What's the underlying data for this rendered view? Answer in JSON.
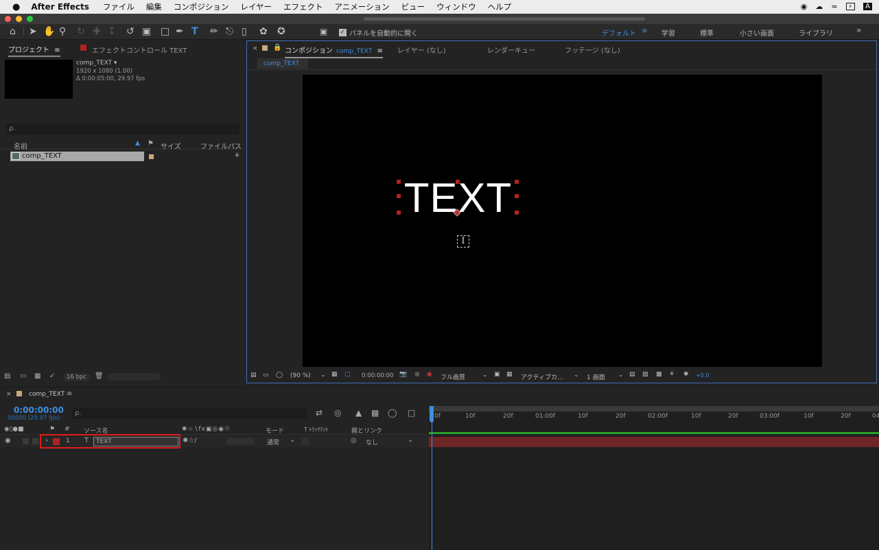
{
  "menubar": {
    "apple_icon": "apple-logo",
    "app_name": "After Effects",
    "items": [
      "ファイル",
      "編集",
      "コンポジション",
      "レイヤー",
      "エフェクト",
      "アニメーション",
      "ビュー",
      "ウィンドウ",
      "ヘルプ"
    ],
    "input_indicator": "A"
  },
  "toolbar": {
    "auto_open_label": "パネルを自動的に開く",
    "workspaces": [
      "デフォルト",
      "学習",
      "標準",
      "小さい画面",
      "ライブラリ"
    ],
    "more": "»"
  },
  "project_panel": {
    "tab_project": "プロジェクト",
    "tab_effect_controls": "エフェクトコントロール TEXT",
    "item_name": "comp_TEXT ▾",
    "item_resolution": "1920 x 1080 (1.00)",
    "item_duration": "Δ 0:00:05:00, 29.97 fps",
    "search_placeholder": "ρ.",
    "col_name": "名前",
    "col_size": "サイズ",
    "col_filepath": "ファイルパス",
    "row_name": "comp_TEXT",
    "bpc": "16 bpc"
  },
  "comp_panel": {
    "tab_composition": "コンポジション",
    "tab_comp_name": "comp_TEXT",
    "tab_layer": "レイヤー (なし)",
    "tab_render_queue": "レンダーキュー",
    "tab_footage": "フッテージ (なし)",
    "sub_tab": "comp_TEXT",
    "canvas_text": "TEXT",
    "zoom": "(90 %)",
    "timecode": "0:00:00:00",
    "resolution": "フル画質",
    "camera": "アクティブカ...",
    "views": "1 画面",
    "exposure": "+0.0"
  },
  "timeline": {
    "tab_name": "comp_TEXT",
    "timecode": "0:00:00:00",
    "frames": "00000 (29.97 fps)",
    "search_placeholder": "ρ.",
    "col_number": "#",
    "col_source": "ソース名",
    "col_mode": "モード",
    "col_trkmat": "T  ﾄﾗｯｸﾏｯﾄ",
    "col_parent": "親とリンク",
    "layer_number": "1",
    "layer_type": "T",
    "layer_name": "TEXT",
    "layer_mode": "通常",
    "layer_parent": "なし",
    "ruler": [
      "0f",
      "10f",
      "20f",
      "01:00f",
      "10f",
      "20f",
      "02:00f",
      "10f",
      "20f",
      "03:00f",
      "10f",
      "20f",
      "04"
    ]
  },
  "colors": {
    "accent_blue": "#3d8ee0",
    "layer_red": "#b02222",
    "highlight_red": "#e31b1b",
    "layer_bar": "#6e2626",
    "workarea_green": "#2aa02a"
  }
}
